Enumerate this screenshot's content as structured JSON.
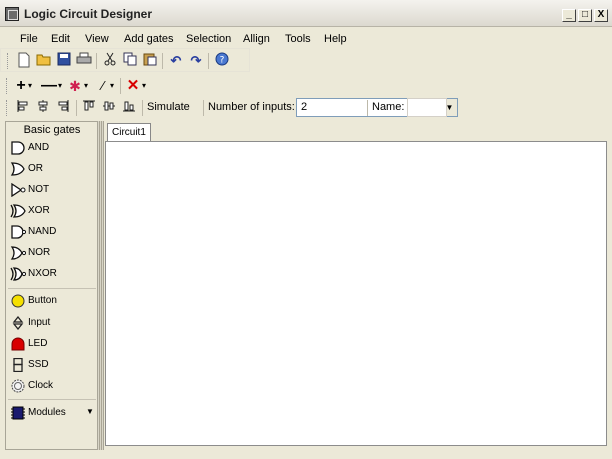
{
  "window": {
    "title": "Logic Circuit Designer",
    "minimize": "_",
    "maximize": "□",
    "close": "X"
  },
  "menu": [
    "File",
    "Edit",
    "View",
    "Add gates",
    "Selection",
    "Allign",
    "Tools",
    "Help"
  ],
  "toolbar_main": {
    "icons": [
      "new-icon",
      "open-icon",
      "save-icon",
      "print-icon",
      "cut-icon",
      "copy-icon",
      "paste-icon",
      "undo-icon",
      "redo-icon",
      "help-icon"
    ]
  },
  "toolbar_draw": {
    "icons": [
      "add-wire-icon",
      "remove-wire-icon",
      "junction-icon",
      "line-icon",
      "delete-icon"
    ]
  },
  "toolbar_align": {
    "simulate_label": "Simulate",
    "inputs_label": "Number of inputs:",
    "inputs_value": "2",
    "name_label": "Name:",
    "name_value": ""
  },
  "sidebar": {
    "title": "Basic gates",
    "gates": [
      "AND",
      "OR",
      "NOT",
      "XOR",
      "NAND",
      "NOR",
      "NXOR"
    ],
    "components": [
      "Button",
      "Input",
      "LED",
      "SSD",
      "Clock"
    ],
    "modules_label": "Modules",
    "colors": {
      "button": "#f5e000",
      "led": "#d80000",
      "modules": "#1a1a6e"
    }
  },
  "document": {
    "tab_label": "Circuit1"
  }
}
